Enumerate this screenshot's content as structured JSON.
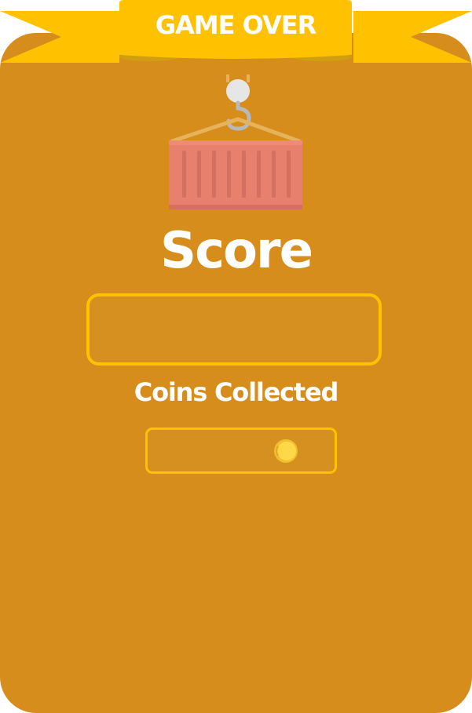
{
  "banner": {
    "title": "GAME OVER"
  },
  "score": {
    "title": "Score",
    "value": ""
  },
  "coins": {
    "title": "Coins Collected",
    "value": ""
  },
  "colors": {
    "panel": "#d68d1b",
    "banner": "#ffc100",
    "banner_shadow": "#d09e10",
    "container": "#e8806e",
    "box_border": "#ffc100",
    "text": "#ffffff"
  },
  "icons": {
    "hero": "cargo-container-crane-icon",
    "coin": "coin-icon"
  }
}
